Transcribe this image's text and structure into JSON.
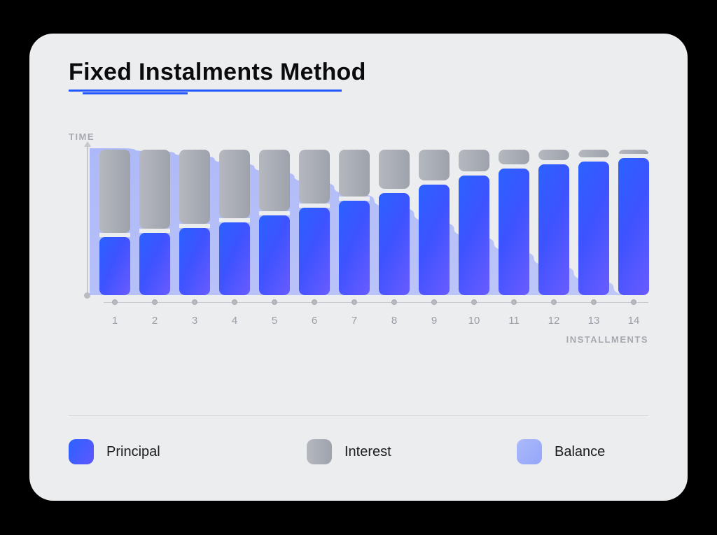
{
  "title": "Fixed Instalments Method",
  "ylabel": "TIME",
  "xlabel": "INSTALLMENTS",
  "legend": {
    "principal": "Principal",
    "interest": "Interest",
    "balance": "Balance"
  },
  "chart_data": {
    "type": "bar",
    "title": "Fixed Instalments Method",
    "xlabel": "INSTALLMENTS",
    "ylabel": "TIME",
    "categories": [
      "1",
      "2",
      "3",
      "4",
      "5",
      "6",
      "7",
      "8",
      "9",
      "10",
      "11",
      "12",
      "13",
      "14"
    ],
    "series": [
      {
        "name": "Principal",
        "values": [
          40,
          43,
          46,
          50,
          55,
          60,
          65,
          70,
          76,
          82,
          87,
          90,
          92,
          94
        ]
      },
      {
        "name": "Interest",
        "values": [
          60,
          57,
          54,
          50,
          45,
          40,
          35,
          30,
          24,
          18,
          13,
          10,
          8,
          6
        ]
      },
      {
        "name": "Balance",
        "values": [
          100,
          98,
          95,
          90,
          84,
          77,
          69,
          60,
          50,
          40,
          30,
          20,
          10,
          0
        ]
      }
    ],
    "ylim": [
      0,
      100
    ]
  }
}
